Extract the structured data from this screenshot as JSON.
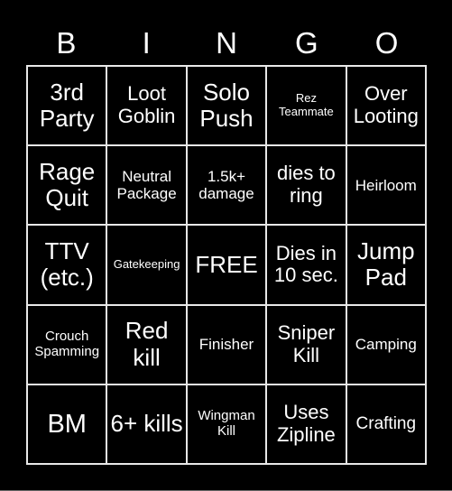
{
  "header": [
    "B",
    "I",
    "N",
    "G",
    "O"
  ],
  "cells": [
    {
      "text": "3rd Party",
      "size": "s-l"
    },
    {
      "text": "Loot Goblin",
      "size": "s-m"
    },
    {
      "text": "Solo Push",
      "size": "s-l"
    },
    {
      "text": "Rez Teammate",
      "size": "s-xxs"
    },
    {
      "text": "Over Looting",
      "size": "s-m"
    },
    {
      "text": "Rage Quit",
      "size": "s-l"
    },
    {
      "text": "Neutral Package",
      "size": "s-s"
    },
    {
      "text": "1.5k+ damage",
      "size": "s-s"
    },
    {
      "text": "dies to ring",
      "size": "s-m"
    },
    {
      "text": "Heirloom",
      "size": "s-s"
    },
    {
      "text": "TTV (etc.)",
      "size": "s-l"
    },
    {
      "text": "Gatekeeping",
      "size": "s-xxs"
    },
    {
      "text": "FREE",
      "size": "s-l"
    },
    {
      "text": "Dies in 10 sec.",
      "size": "s-m"
    },
    {
      "text": "Jump Pad",
      "size": "s-l"
    },
    {
      "text": "Crouch Spamming",
      "size": "s-xs"
    },
    {
      "text": "Red kill",
      "size": "s-l"
    },
    {
      "text": "Finisher",
      "size": "s-s"
    },
    {
      "text": "Sniper Kill",
      "size": "s-m"
    },
    {
      "text": "Camping",
      "size": "s-s"
    },
    {
      "text": "BM",
      "size": "s-xl"
    },
    {
      "text": "6+ kills",
      "size": "s-l"
    },
    {
      "text": "Wingman Kill",
      "size": "s-xs"
    },
    {
      "text": "Uses Zipline",
      "size": "s-m"
    },
    {
      "text": "Crafting",
      "size": "s-sm"
    }
  ]
}
